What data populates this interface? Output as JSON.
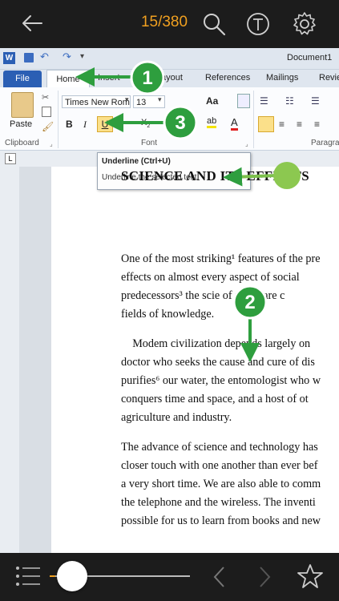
{
  "app_bar": {
    "page_indicator": "15/380",
    "icons": [
      "back-arrow-icon",
      "search-icon",
      "font-icon",
      "gear-icon"
    ]
  },
  "word": {
    "doc_title": "Document1",
    "tabs": {
      "file": "File",
      "home": "Home",
      "insert": "Insert",
      "layout": "ayout",
      "references": "References",
      "mailings": "Mailings",
      "review": "Revie"
    },
    "ribbon": {
      "paste_label": "Paste",
      "font_name": "Times New Rom",
      "font_size": "13",
      "aa_label": "Aa",
      "bold": "B",
      "italic": "I",
      "underline": "U",
      "clipboard_label": "Clipboard",
      "font_group_label": "Font",
      "paragraph_label": "Paragra"
    },
    "tooltip": {
      "title": "Underline (Ctrl+U)",
      "desc": "Underline the selected text."
    },
    "document": {
      "heading": "SCIENCE AND ITS EFFECTS",
      "para1": [
        "One of the most striking¹ features of the pre",
        "effects on almost every aspect of social",
        "predecessors³ the scie      of today are c",
        "fields of knowledge."
      ],
      "para2": [
        "    Modem civilization depends largely on",
        "doctor who seeks the cause and cure of dis",
        "purifies⁶ our water, the entomologist who w",
        "conquers time and space, and a host of ot",
        "agriculture and industry."
      ],
      "para3": [
        "The advance of science and technology has",
        "closer touch with one another than ever bef",
        "a very short time. We are also able to comm",
        "the telephone and the wireless. The inventi",
        "possible for us to learn from books and new"
      ]
    }
  },
  "callouts": {
    "one": "1",
    "two": "2",
    "three": "3",
    "color": "#2e9e3e"
  },
  "bottom_bar": {
    "progress_fraction": 0.04,
    "icons": [
      "list-icon",
      "prev-icon",
      "next-icon",
      "star-icon"
    ]
  }
}
